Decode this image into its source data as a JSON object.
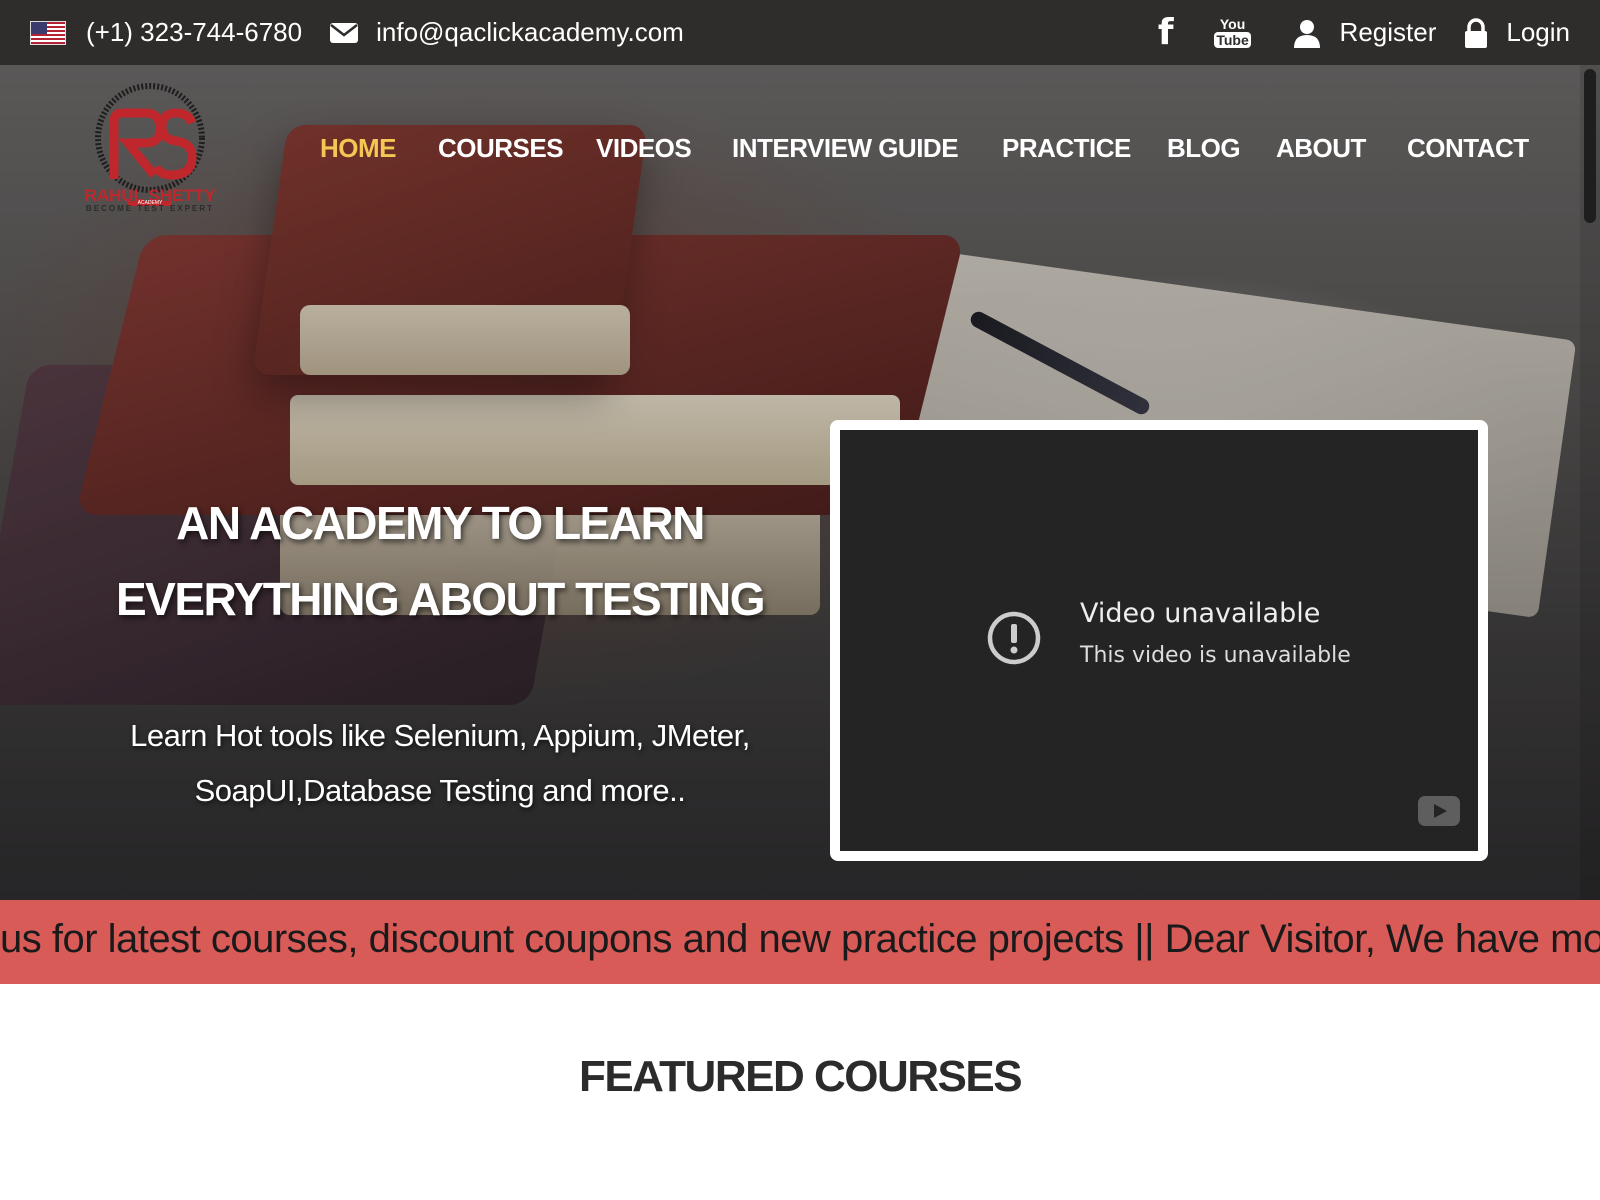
{
  "topbar": {
    "phone": "(+1) 323-744-6780",
    "email": "info@qaclickacademy.com",
    "register_label": "Register",
    "login_label": "Login",
    "youtube_you": "You",
    "youtube_tube": "Tube"
  },
  "logo": {
    "name": "RAHUL SHETTY",
    "academy": "ACADEMY",
    "tagline": "BECOME TEST EXPERT"
  },
  "nav": {
    "items": [
      "HOME",
      "COURSES",
      "VIDEOS",
      "INTERVIEW GUIDE",
      "PRACTICE",
      "BLOG",
      "ABOUT",
      "CONTACT"
    ],
    "active": "HOME",
    "active_color": "#f4c653"
  },
  "hero": {
    "headline_line1": "AN ACADEMY TO LEARN",
    "headline_line2": "EVERYTHING ABOUT TESTING",
    "subline_line1": "Learn Hot tools like Selenium, Appium, JMeter,",
    "subline_line2": "SoapUI,Database Testing and more.."
  },
  "video": {
    "title": "Video unavailable",
    "message": "This video is unavailable"
  },
  "ticker": {
    "text": "us for latest courses, discount coupons and new practice projects || Dear Visitor, We have mo",
    "background": "#d95b58"
  },
  "featured": {
    "title": "FEATURED COURSES"
  },
  "icons": [
    "us-flag-icon",
    "mail-icon",
    "facebook-icon",
    "youtube-icon",
    "user-icon",
    "lock-icon",
    "alert-icon",
    "youtube-play-icon"
  ]
}
